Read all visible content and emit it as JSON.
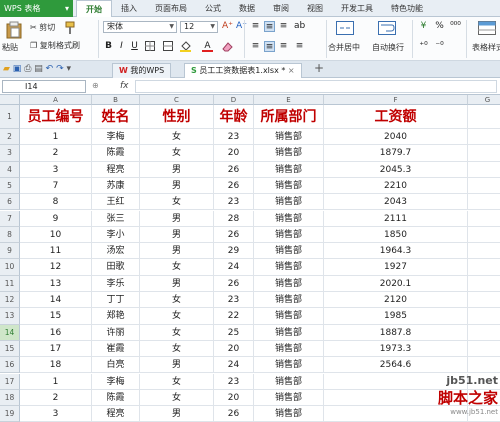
{
  "app": {
    "title": "WPS 表格",
    "dropdown": "▾"
  },
  "menu": [
    "开始",
    "插入",
    "页面布局",
    "公式",
    "数据",
    "审阅",
    "视图",
    "开发工具",
    "特色功能"
  ],
  "ribbon": {
    "paste": "粘贴",
    "cut": "剪切",
    "copy": "复制",
    "format_painter": "格式刷",
    "font": "宋体",
    "size": "12",
    "bold": "B",
    "italic": "I",
    "underline": "U",
    "merge": "合并居中",
    "wrap": "自动换行",
    "percent": "%",
    "table_style": "表格样式"
  },
  "tabs": {
    "home": "我的WPS",
    "file": "员工工资数据表1.xlsx *",
    "new": "+"
  },
  "formula": {
    "cell_ref": "I14",
    "fx": "fx",
    "value": ""
  },
  "columns": [
    "A",
    "B",
    "C",
    "D",
    "E",
    "F",
    "G"
  ],
  "table": {
    "headers": [
      "员工编号",
      "姓名",
      "性别",
      "年龄",
      "所属部门",
      "工资额"
    ],
    "rows": [
      [
        "1",
        "李梅",
        "女",
        "23",
        "销售部",
        "2040"
      ],
      [
        "2",
        "陈霞",
        "女",
        "20",
        "销售部",
        "1879.7"
      ],
      [
        "3",
        "程亮",
        "男",
        "26",
        "销售部",
        "2045.3"
      ],
      [
        "7",
        "苏康",
        "男",
        "26",
        "销售部",
        "2210"
      ],
      [
        "8",
        "王红",
        "女",
        "23",
        "销售部",
        "2043"
      ],
      [
        "9",
        "张三",
        "男",
        "28",
        "销售部",
        "2111"
      ],
      [
        "10",
        "李小",
        "男",
        "26",
        "销售部",
        "1850"
      ],
      [
        "11",
        "汤宏",
        "男",
        "29",
        "销售部",
        "1964.3"
      ],
      [
        "12",
        "田歌",
        "女",
        "24",
        "销售部",
        "1927"
      ],
      [
        "13",
        "李乐",
        "男",
        "26",
        "销售部",
        "2020.1"
      ],
      [
        "14",
        "丁丁",
        "女",
        "23",
        "销售部",
        "2120"
      ],
      [
        "15",
        "郑艳",
        "女",
        "22",
        "销售部",
        "1985"
      ],
      [
        "16",
        "许丽",
        "女",
        "25",
        "销售部",
        "1887.8"
      ],
      [
        "17",
        "崔霞",
        "女",
        "20",
        "销售部",
        "1973.3"
      ],
      [
        "18",
        "白亮",
        "男",
        "24",
        "销售部",
        "2564.6"
      ],
      [
        "1",
        "李梅",
        "女",
        "23",
        "销售部",
        ""
      ],
      [
        "2",
        "陈霞",
        "女",
        "20",
        "销售部",
        ""
      ],
      [
        "3",
        "程亮",
        "男",
        "26",
        "销售部",
        ""
      ]
    ]
  },
  "selected_row": "14",
  "watermark": {
    "line1": "jb51.net",
    "line2": "脚本之家",
    "line3": "www.jb51.net"
  }
}
